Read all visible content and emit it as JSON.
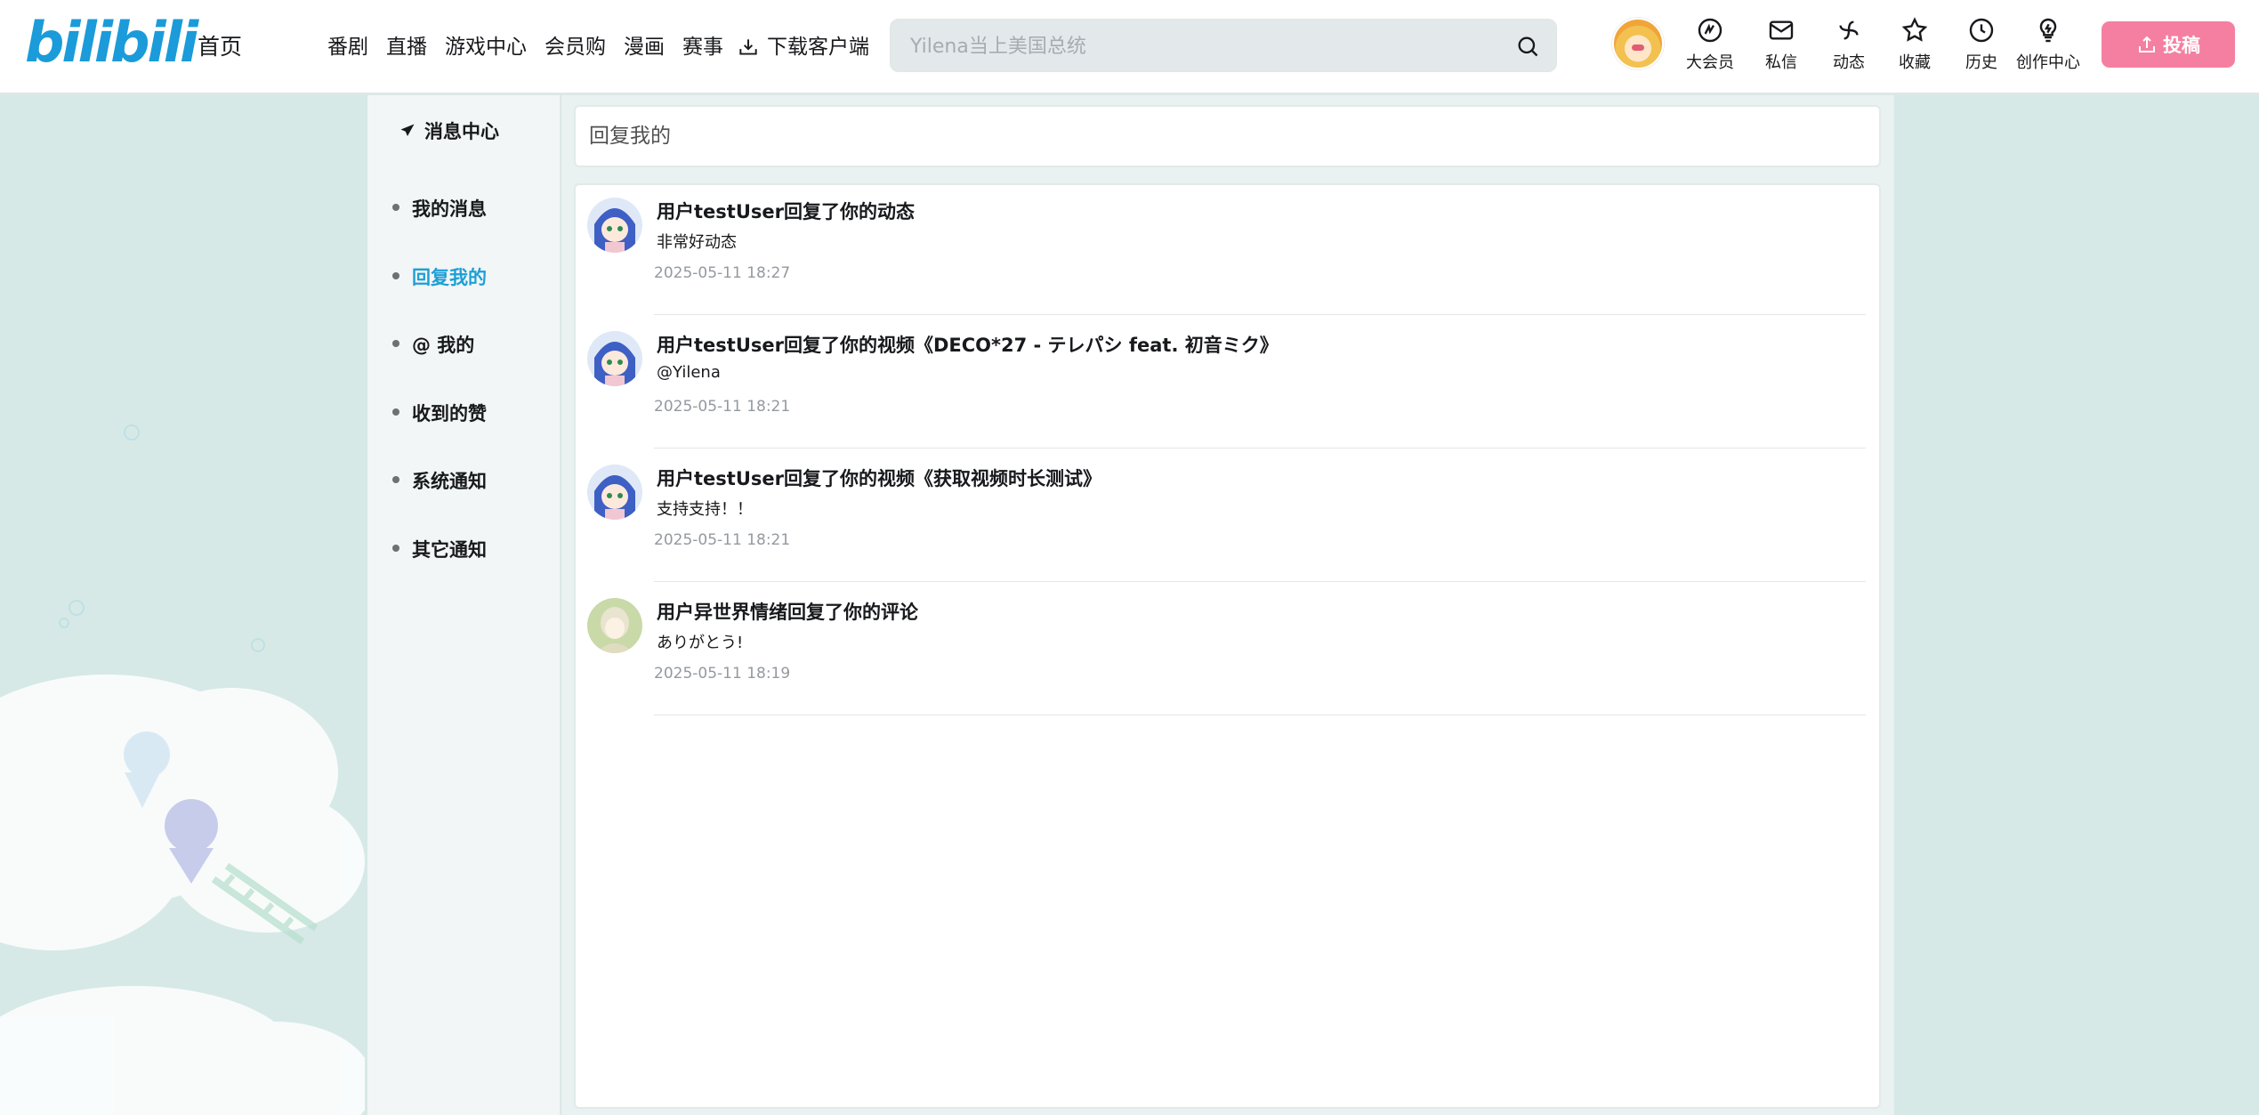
{
  "header": {
    "logo_text": "bilibili",
    "home": "首页",
    "nav": [
      "番剧",
      "直播",
      "游戏中心",
      "会员购",
      "漫画",
      "赛事"
    ],
    "download": "下载客户端",
    "search_placeholder": "Yilena当上美国总统",
    "tools": [
      {
        "label": "大会员",
        "icon": "vip-icon"
      },
      {
        "label": "私信",
        "icon": "mail-icon"
      },
      {
        "label": "动态",
        "icon": "windmill-icon"
      },
      {
        "label": "收藏",
        "icon": "star-icon"
      },
      {
        "label": "历史",
        "icon": "clock-icon"
      },
      {
        "label": "创作中心",
        "icon": "lightbulb-icon"
      }
    ],
    "upload": "投稿"
  },
  "sidebar": {
    "title": "消息中心",
    "items": [
      {
        "label": "我的消息"
      },
      {
        "label": "回复我的"
      },
      {
        "label": "@ 我的"
      },
      {
        "label": "收到的赞"
      },
      {
        "label": "系统通知"
      },
      {
        "label": "其它通知"
      }
    ],
    "active_index": 1
  },
  "main": {
    "heading": "回复我的",
    "messages": [
      {
        "title": "用户testUser回复了你的动态",
        "content": "非常好动态",
        "time": "2025-05-11 18:27"
      },
      {
        "title": "用户testUser回复了你的视频《DECO*27 - テレパシ feat. 初音ミク》",
        "content": "@Yilena",
        "time": "2025-05-11 18:21"
      },
      {
        "title": "用户testUser回复了你的视频《获取视频时长测试》",
        "content": "支持支持！！",
        "time": "2025-05-11 18:21"
      },
      {
        "title": "用户异世界情绪回复了你的评论",
        "content": "ありがとう!",
        "time": "2025-05-11 18:19"
      }
    ]
  },
  "colors": {
    "brand_blue": "#1b9bd9",
    "active_blue": "#1d9fd6",
    "upload_pink": "#f57fa0",
    "page_bg": "#d7e9e7"
  }
}
